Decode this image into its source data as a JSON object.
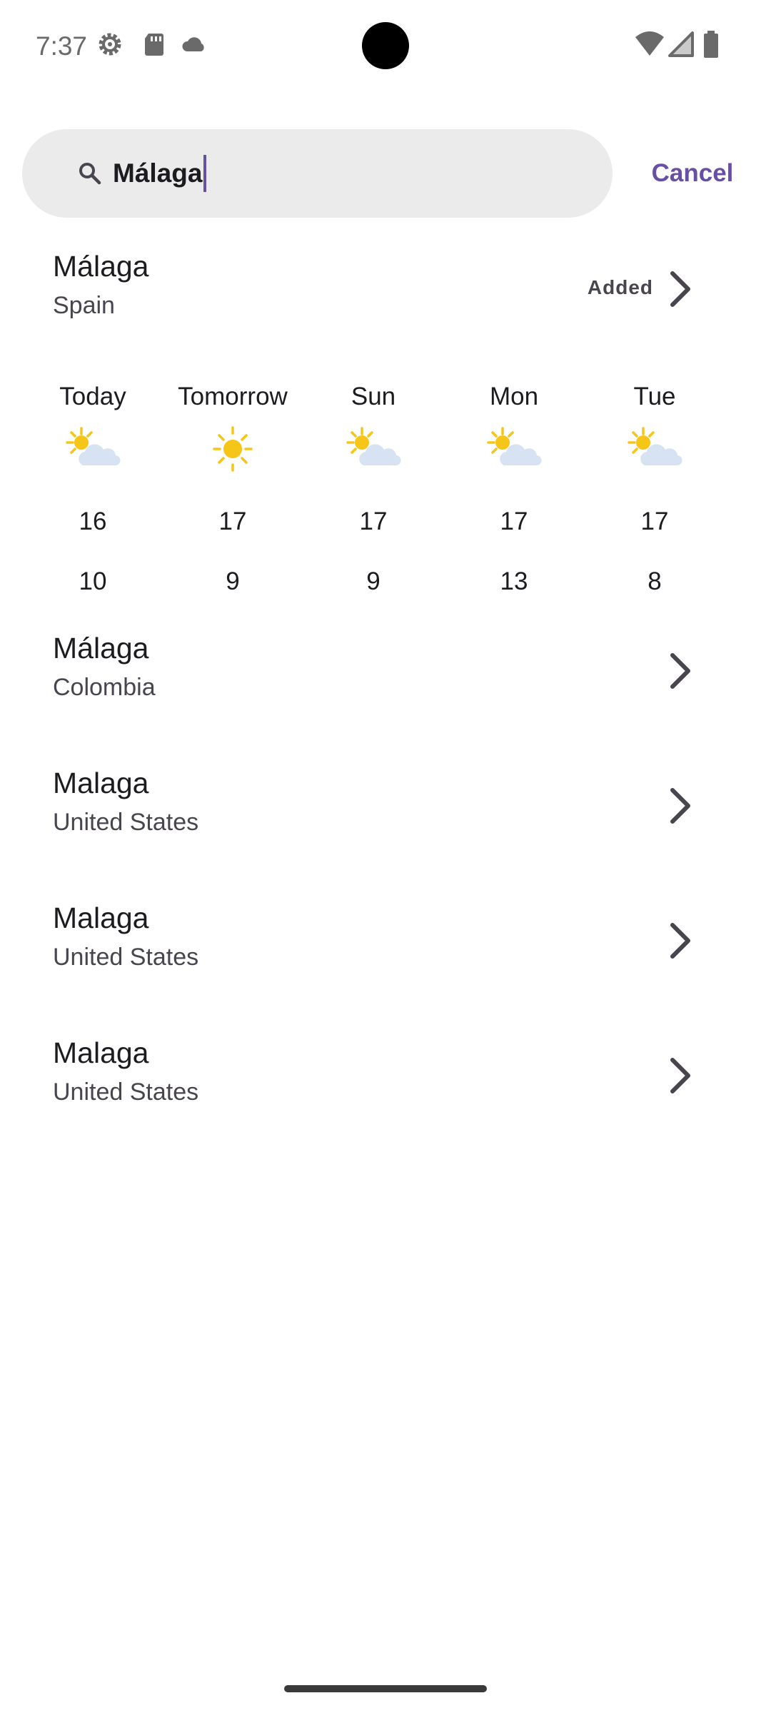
{
  "status_bar": {
    "time": "7:37",
    "left_icons": [
      "settings-gear-icon",
      "sd-card-icon",
      "cloud-icon"
    ],
    "right_icons": [
      "wifi-icon",
      "cellular-signal-icon",
      "battery-icon"
    ]
  },
  "search": {
    "value": "Málaga",
    "cancel_label": "Cancel"
  },
  "results": [
    {
      "name": "Málaga",
      "country": "Spain",
      "status": "Added"
    },
    {
      "name": "Málaga",
      "country": "Colombia"
    },
    {
      "name": "Malaga",
      "country": "United States"
    },
    {
      "name": "Malaga",
      "country": "United States"
    },
    {
      "name": "Malaga",
      "country": "United States"
    }
  ],
  "forecast": [
    {
      "day": "Today",
      "icon": "partly-cloudy-icon",
      "high": "16",
      "low": "10"
    },
    {
      "day": "Tomorrow",
      "icon": "sunny-icon",
      "high": "17",
      "low": "9"
    },
    {
      "day": "Sun",
      "icon": "partly-cloudy-icon",
      "high": "17",
      "low": "9"
    },
    {
      "day": "Mon",
      "icon": "partly-cloudy-icon",
      "high": "17",
      "low": "13"
    },
    {
      "day": "Tue",
      "icon": "partly-cloudy-icon",
      "high": "17",
      "low": "8"
    }
  ],
  "colors": {
    "accent": "#6750a4",
    "search_bg": "#ebebeb",
    "sun": "#f5c518",
    "cloud": "#d7e3f2"
  }
}
